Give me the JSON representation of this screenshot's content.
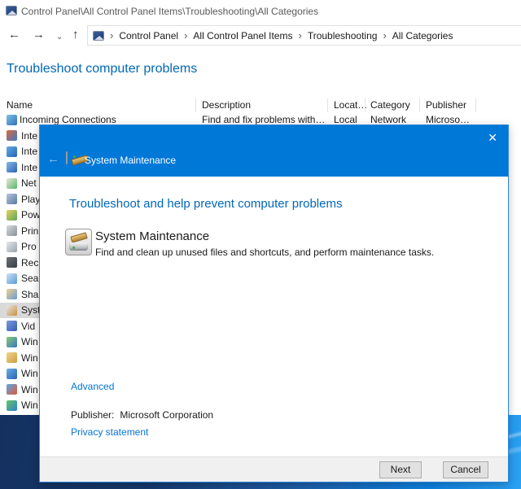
{
  "window": {
    "title": "Control Panel\\All Control Panel Items\\Troubleshooting\\All Categories"
  },
  "nav": {
    "back_glyph": "←",
    "forward_glyph": "→",
    "dropdown_glyph": "⌄",
    "up_glyph": "↑",
    "separator_glyph": "›",
    "breadcrumb": [
      {
        "label": "Control Panel"
      },
      {
        "label": "All Control Panel Items"
      },
      {
        "label": "Troubleshooting"
      },
      {
        "label": "All Categories"
      }
    ]
  },
  "page": {
    "heading": "Troubleshoot computer problems"
  },
  "table": {
    "columns": [
      {
        "label": "Name"
      },
      {
        "label": "Description"
      },
      {
        "label": "Locat…"
      },
      {
        "label": "Category"
      },
      {
        "label": "Publisher"
      }
    ],
    "row1": {
      "name": "Incoming Connections",
      "description": "Find and fix problems with…",
      "location": "Local",
      "category": "Network",
      "publisher": "Microso…"
    },
    "rows": [
      {
        "label": "Inte"
      },
      {
        "label": "Inte"
      },
      {
        "label": "Inte"
      },
      {
        "label": "Net"
      },
      {
        "label": "Play"
      },
      {
        "label": "Pow"
      },
      {
        "label": "Prin"
      },
      {
        "label": "Pro"
      },
      {
        "label": "Rec"
      },
      {
        "label": "Sea"
      },
      {
        "label": "Sha"
      },
      {
        "label": "Syst"
      },
      {
        "label": "Vid"
      },
      {
        "label": "Win"
      },
      {
        "label": "Win"
      },
      {
        "label": "Win"
      },
      {
        "label": "Win"
      },
      {
        "label": "Win"
      }
    ]
  },
  "dialog": {
    "back_glyph": "←",
    "close_glyph": "✕",
    "title": "System Maintenance",
    "heading": "Troubleshoot and help prevent computer problems",
    "item": {
      "title": "System Maintenance",
      "description": "Find and clean up unused files and shortcuts, and perform maintenance tasks."
    },
    "advanced_label": "Advanced",
    "publisher_label": "Publisher:",
    "publisher_value": "Microsoft Corporation",
    "privacy_label": "Privacy statement",
    "next_label": "Next",
    "cancel_label": "Cancel"
  },
  "colors": {
    "accent_blue": "#0078d7",
    "heading_blue": "#0068b8",
    "link_blue": "#0574d4",
    "selected_row": "#d9d9d9",
    "desktop_dark": "#122c57",
    "desktop_bright": "#0d83e4"
  }
}
